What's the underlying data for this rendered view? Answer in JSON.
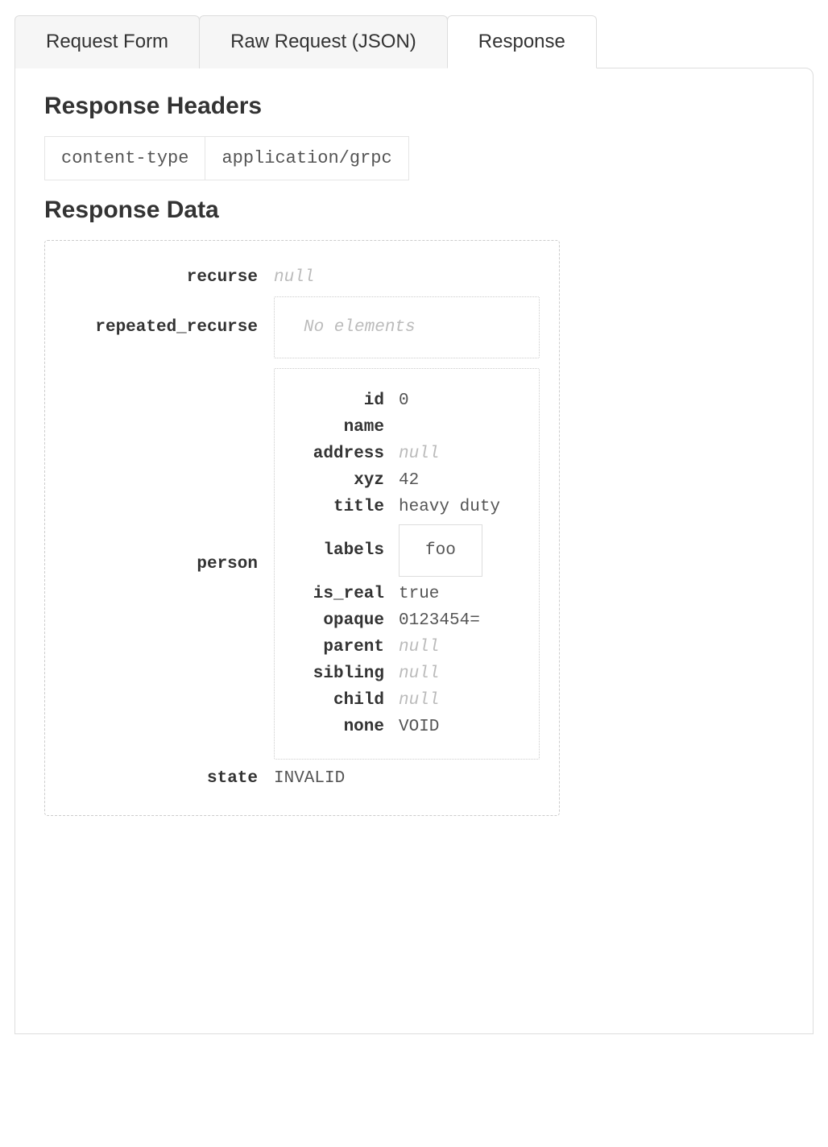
{
  "tabs": {
    "request_form": "Request Form",
    "raw_request": "Raw Request (JSON)",
    "response": "Response"
  },
  "sections": {
    "response_headers": "Response Headers",
    "response_data": "Response Data"
  },
  "headers": {
    "key": "content-type",
    "value": "application/grpc"
  },
  "data": {
    "labels": {
      "recurse": "recurse",
      "repeated_recurse": "repeated_recurse",
      "person": "person",
      "state": "state"
    },
    "no_elements": "No elements",
    "null_text": "null",
    "recurse": null,
    "person_labels": {
      "id": "id",
      "name": "name",
      "address": "address",
      "xyz": "xyz",
      "title": "title",
      "labels": "labels",
      "is_real": "is_real",
      "opaque": "opaque",
      "parent": "parent",
      "sibling": "sibling",
      "child": "child",
      "none": "none"
    },
    "person": {
      "id": "0",
      "name": "",
      "xyz": "42",
      "title": "heavy duty",
      "labels_0": "foo",
      "is_real": "true",
      "opaque": "0123454=",
      "none": "VOID"
    },
    "state": "INVALID"
  }
}
